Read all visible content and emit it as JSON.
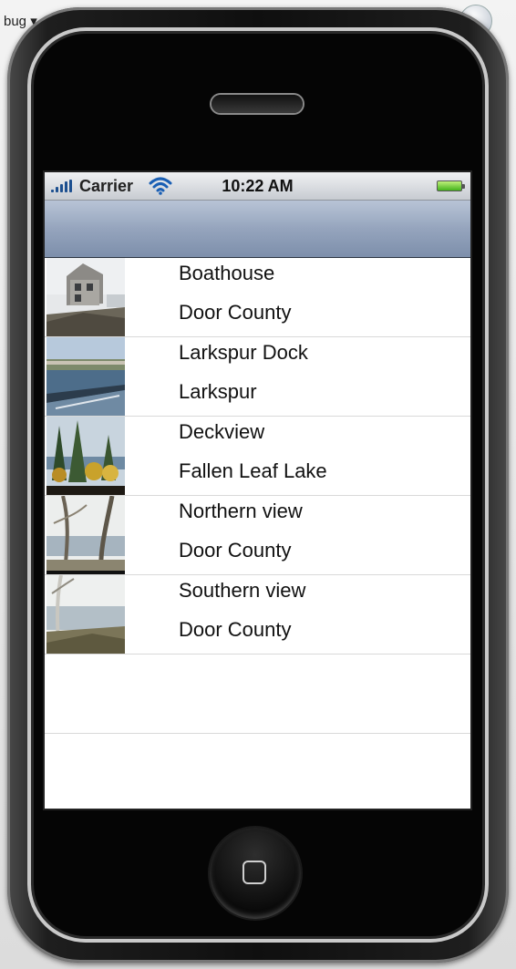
{
  "background": {
    "menu_label": "bug ▾"
  },
  "status_bar": {
    "carrier": "Carrier",
    "time": "10:22 AM"
  },
  "nav_bar": {
    "title": ""
  },
  "items": [
    {
      "title": "Boathouse",
      "subtitle": "Door County",
      "thumb": "boathouse-photo"
    },
    {
      "title": "Larkspur Dock",
      "subtitle": "Larkspur",
      "thumb": "dock-photo"
    },
    {
      "title": "Deckview",
      "subtitle": "Fallen Leaf Lake",
      "thumb": "deck-photo"
    },
    {
      "title": "Northern view",
      "subtitle": "Door County",
      "thumb": "northern-photo"
    },
    {
      "title": "Southern view",
      "subtitle": "Door County",
      "thumb": "southern-photo"
    }
  ],
  "colors": {
    "nav_bar": "#95a4bd",
    "battery": "#44b31c",
    "signal": "#1c4f8f"
  }
}
